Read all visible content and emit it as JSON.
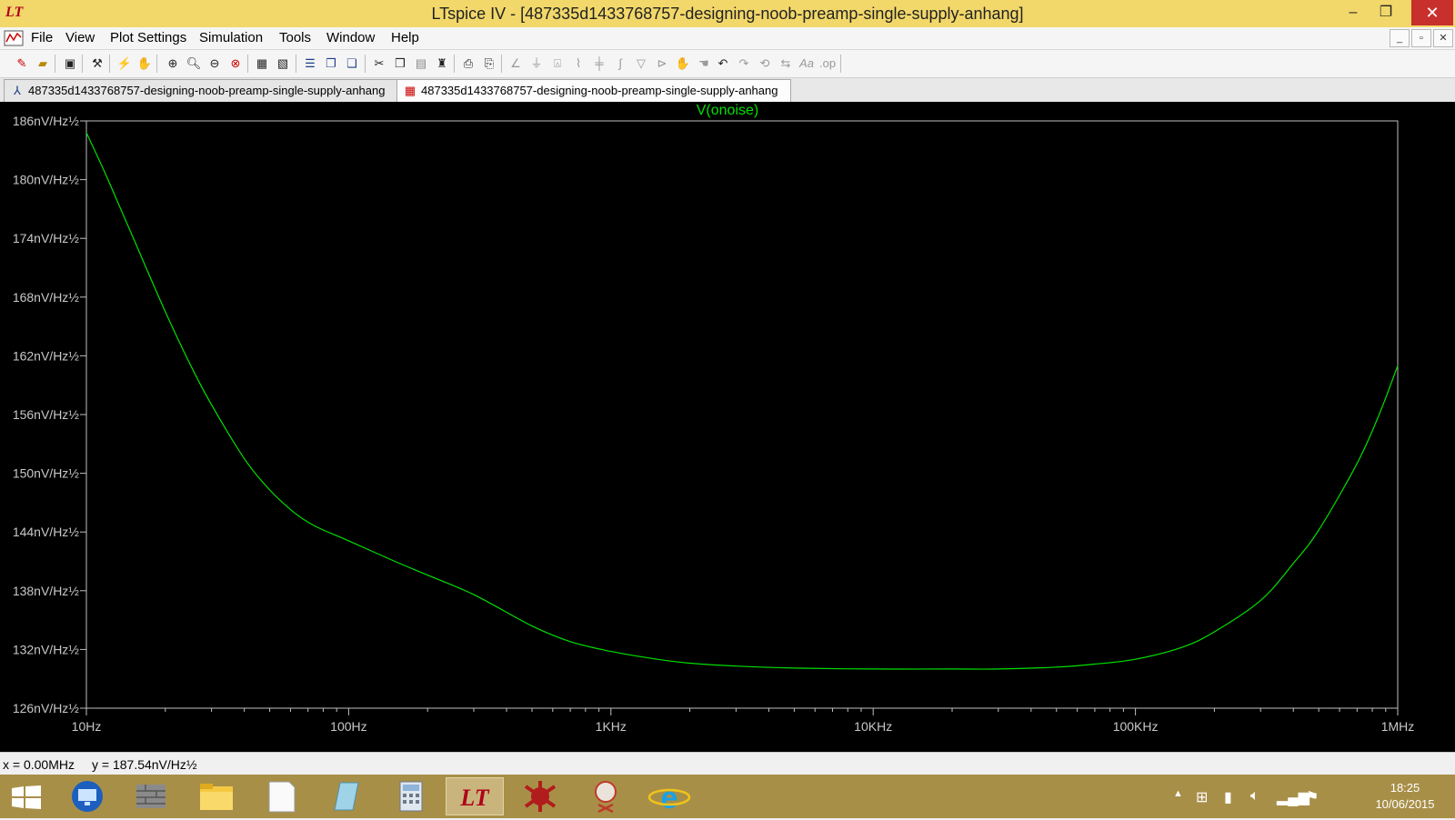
{
  "window": {
    "title": "LTspice IV - [487335d1433768757-designing-noob-preamp-single-supply-anhang]",
    "app_icon_glyph": "LT",
    "controls": {
      "minimize": "–",
      "maximize": "❐",
      "close": "✕"
    }
  },
  "menu": {
    "items": [
      "File",
      "View",
      "Plot Settings",
      "Simulation",
      "Tools",
      "Window",
      "Help"
    ],
    "mdi_controls": [
      "_",
      "▫",
      "✕"
    ]
  },
  "toolbar": {
    "buttons": [
      "new-schematic-icon",
      "open-icon",
      "save-icon",
      "control-panel-icon",
      "run-icon",
      "halt-icon",
      "zoom-in-icon",
      "zoom-box-icon",
      "zoom-out-icon",
      "zoom-cancel-icon",
      "autorange-icon",
      "zoom-extents-icon",
      "tile-horizontal-icon",
      "cascade-icon",
      "tile-vertical-icon",
      "cut-icon",
      "copy-icon",
      "paste-icon",
      "find-icon",
      "print-preview-icon",
      "print-icon",
      "wire-icon",
      "ground-icon",
      "label-icon",
      "resistor-icon",
      "capacitor-icon",
      "inductor-icon",
      "diode-icon",
      "component-icon",
      "move-icon",
      "drag-icon",
      "undo-icon",
      "redo-icon",
      "rotate-icon",
      "mirror-icon",
      "text-icon",
      "spice-directive-icon"
    ]
  },
  "tabs": [
    {
      "label": "487335d1433768757-designing-noob-preamp-single-supply-anhang",
      "icon": "schematic-icon",
      "active": false
    },
    {
      "label": "487335d1433768757-designing-noob-preamp-single-supply-anhang",
      "icon": "waveform-icon",
      "active": true
    }
  ],
  "status": {
    "x_readout": "x = 0.00MHz",
    "y_readout": "y = 187.54nV/Hz½"
  },
  "taskbar": {
    "apps": [
      "start-icon",
      "remote-desktop-icon",
      "firewall-icon",
      "file-explorer-icon",
      "document-icon",
      "notepad-icon",
      "calculator-icon",
      "ltspice-icon",
      "bug-app-icon",
      "snipping-tool-icon",
      "internet-explorer-icon"
    ],
    "clock_time": "18:25",
    "clock_date": "10/06/2015"
  },
  "colors": {
    "trace": "#00e000",
    "plot_background": "#000000",
    "axis": "#c0c0c0",
    "titlebar": "#f2d86a"
  },
  "chart_data": {
    "type": "line",
    "title": "",
    "trace_label": "V(onoise)",
    "x_scale": "log",
    "xlim": [
      10,
      1000000
    ],
    "ylim": [
      126,
      186
    ],
    "x_ticks": [
      {
        "value": 10,
        "label": "10Hz"
      },
      {
        "value": 100,
        "label": "100Hz"
      },
      {
        "value": 1000,
        "label": "1KHz"
      },
      {
        "value": 10000,
        "label": "10KHz"
      },
      {
        "value": 100000,
        "label": "100KHz"
      },
      {
        "value": 1000000,
        "label": "1MHz"
      }
    ],
    "y_ticks": [
      {
        "value": 186,
        "label": "186nV/Hz½"
      },
      {
        "value": 180,
        "label": "180nV/Hz½"
      },
      {
        "value": 174,
        "label": "174nV/Hz½"
      },
      {
        "value": 168,
        "label": "168nV/Hz½"
      },
      {
        "value": 162,
        "label": "162nV/Hz½"
      },
      {
        "value": 156,
        "label": "156nV/Hz½"
      },
      {
        "value": 150,
        "label": "150nV/Hz½"
      },
      {
        "value": 144,
        "label": "144nV/Hz½"
      },
      {
        "value": 138,
        "label": "138nV/Hz½"
      },
      {
        "value": 132,
        "label": "132nV/Hz½"
      },
      {
        "value": 126,
        "label": "126nV/Hz½"
      }
    ],
    "series": [
      {
        "name": "V(onoise)",
        "unit": "nV/Hz½",
        "points": [
          [
            10,
            184.8
          ],
          [
            12,
            180.2
          ],
          [
            15,
            174.2
          ],
          [
            20,
            166.5
          ],
          [
            25,
            161.0
          ],
          [
            30,
            157.0
          ],
          [
            40,
            151.5
          ],
          [
            50,
            148.3
          ],
          [
            60,
            146.3
          ],
          [
            70,
            145.0
          ],
          [
            80,
            144.2
          ],
          [
            100,
            143.1
          ],
          [
            150,
            141.0
          ],
          [
            200,
            139.6
          ],
          [
            300,
            137.6
          ],
          [
            500,
            134.4
          ],
          [
            700,
            132.8
          ],
          [
            1000,
            131.8
          ],
          [
            1500,
            131.0
          ],
          [
            2000,
            130.6
          ],
          [
            3000,
            130.3
          ],
          [
            5000,
            130.1
          ],
          [
            10000,
            130.0
          ],
          [
            20000,
            130.0
          ],
          [
            30000,
            130.0
          ],
          [
            50000,
            130.2
          ],
          [
            70000,
            130.5
          ],
          [
            100000,
            131.0
          ],
          [
            150000,
            132.2
          ],
          [
            200000,
            133.8
          ],
          [
            300000,
            137.0
          ],
          [
            400000,
            140.8
          ],
          [
            500000,
            144.2
          ],
          [
            700000,
            151.0
          ],
          [
            850000,
            156.0
          ],
          [
            1000000,
            161.0
          ]
        ]
      }
    ]
  }
}
